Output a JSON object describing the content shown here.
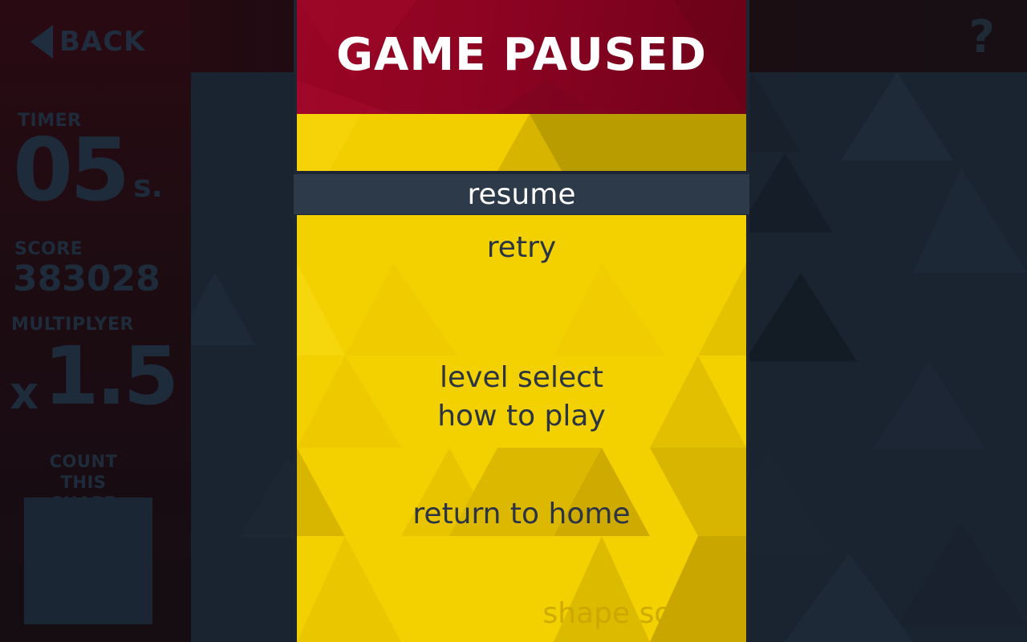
{
  "colors": {
    "header_red": "#8c0322",
    "menu_yellow": "#f3d000",
    "resume_bar": "#2c3a4a",
    "menu_text": "#2b3444",
    "dim_background": "#1a2431"
  },
  "nav": {
    "back_icon": "left-triangle-icon",
    "back_label": "BACK",
    "help_label": "?"
  },
  "stats": {
    "timer_label": "TIMER",
    "timer_value": "05",
    "timer_unit": "s.",
    "score_label": "SCORE",
    "score_value": "383028",
    "multiplier_label": "MULTIPLYER",
    "multiplier_prefix": "x",
    "multiplier_value": "1.5",
    "count_label_line1": "COUNT",
    "count_label_line2": "THIS SHAPE"
  },
  "pause_menu": {
    "title": "GAME PAUSED",
    "resume": "resume",
    "retry": "retry",
    "level_select": "level select",
    "how_to_play": "how to play",
    "return_home": "return to home",
    "game_name": "shape sorting"
  }
}
